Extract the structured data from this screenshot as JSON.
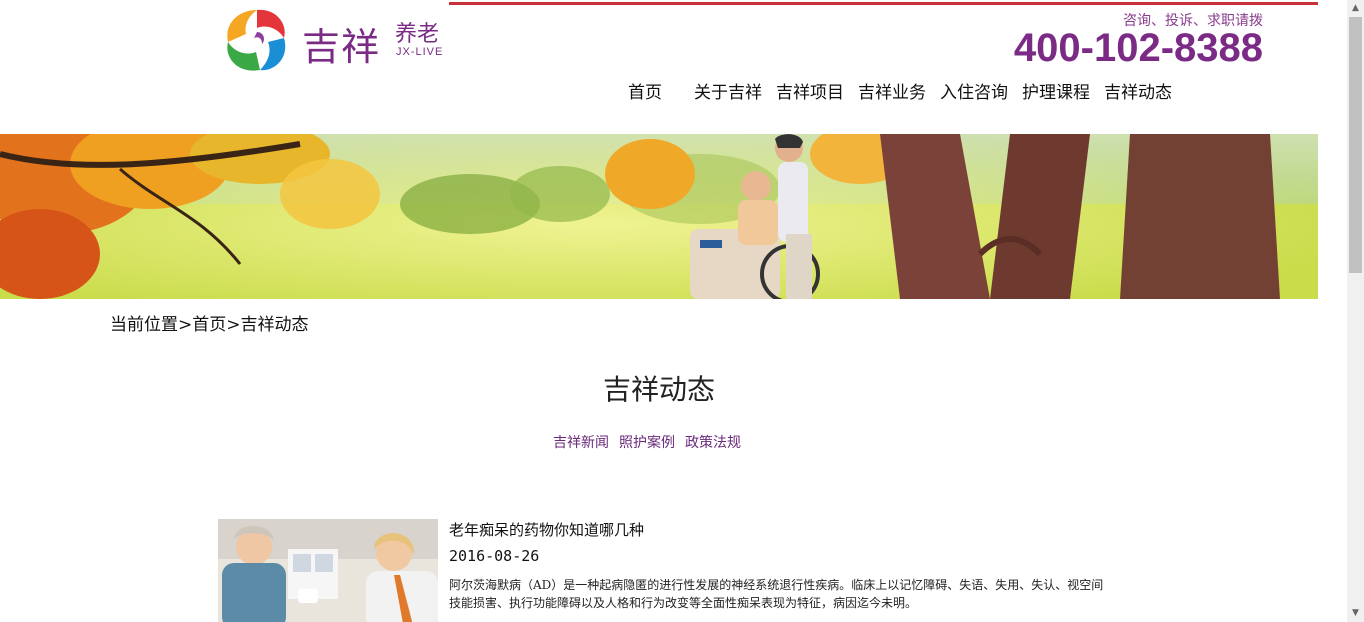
{
  "brand": {
    "name": "吉祥",
    "tagline": "养老",
    "en": "JX-LIVE"
  },
  "hotline": {
    "label": "咨询、投诉、求职请拨",
    "number": "400-102-8388"
  },
  "nav": {
    "items": [
      "首页",
      "关于吉祥",
      "吉祥项目",
      "吉祥业务",
      "入住咨询",
      "护理课程",
      "吉祥动态"
    ]
  },
  "breadcrumb": "当前位置>首页>吉祥动态",
  "section": {
    "title": "吉祥动态",
    "tabs": [
      "吉祥新闻",
      "照护案例",
      "政策法规"
    ]
  },
  "articles": [
    {
      "title": "老年痴呆的药物你知道哪几种",
      "date": "2016-08-26",
      "excerpt": "阿尔茨海默病（AD）是一种起病隐匿的进行性发展的神经系统退行性疾病。临床上以记忆障碍、失语、失用、失认、视空间技能损害、执行功能障碍以及人格和行为改变等全面性痴呆表现为特征，病因迄今未明。"
    }
  ],
  "colors": {
    "accent": "#7b2b86",
    "top_line": "#c8303a"
  },
  "icons": {
    "scroll_up": "scroll-up-arrow-icon",
    "scroll_down": "scroll-down-arrow-icon"
  }
}
